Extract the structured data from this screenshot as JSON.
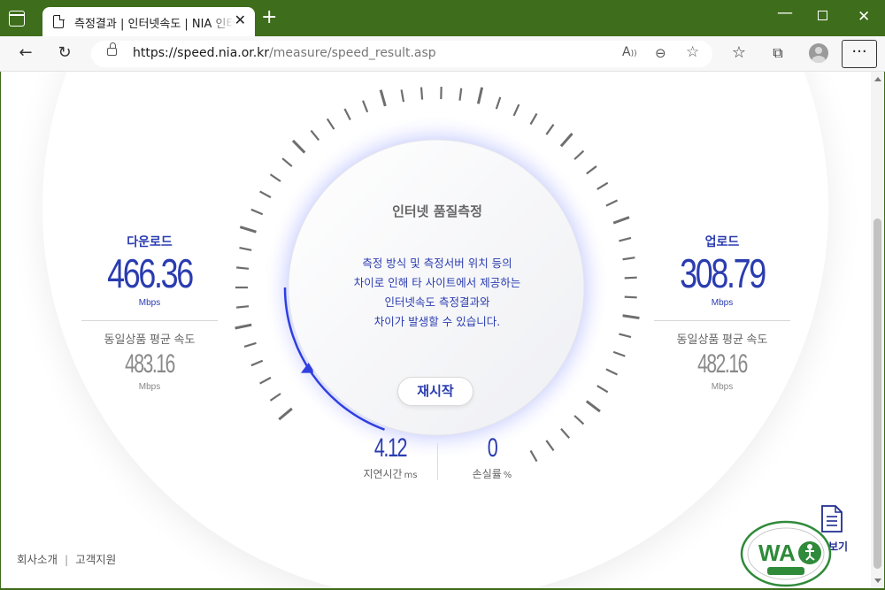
{
  "browser": {
    "tab_title": "측정결과 | 인터넷속도 | NIA 인터넷",
    "url_host": "https://speed.nia.or.kr",
    "url_path": "/measure/speed_result.asp",
    "frame_color": "#3e6d1b"
  },
  "download": {
    "label": "다운로드",
    "value": "466.36",
    "unit": "Mbps",
    "avg_label": "동일상품 평균 속도",
    "avg_value": "483.16",
    "avg_unit": "Mbps"
  },
  "upload": {
    "label": "업로드",
    "value": "308.79",
    "unit": "Mbps",
    "avg_label": "동일상품 평균 속도",
    "avg_value": "482.16",
    "avg_unit": "Mbps"
  },
  "center": {
    "title": "인터넷 품질측정",
    "message": [
      "측정 방식 및 측정서버 위치 등의",
      "차이로 인해 타 사이트에서 제공하는",
      "인터넷속도 측정결과와",
      "차이가 발생할 수 있습니다."
    ],
    "restart_label": "재시작"
  },
  "latency": {
    "value": "4.12",
    "label": "지연시간",
    "unit": "ms"
  },
  "loss": {
    "value": "0",
    "label": "손실률",
    "unit": "%"
  },
  "footer": {
    "about": "회사소개",
    "support": "고객지원"
  },
  "doc_button": {
    "label": "보기"
  },
  "accent_color": "#2a3cb0"
}
